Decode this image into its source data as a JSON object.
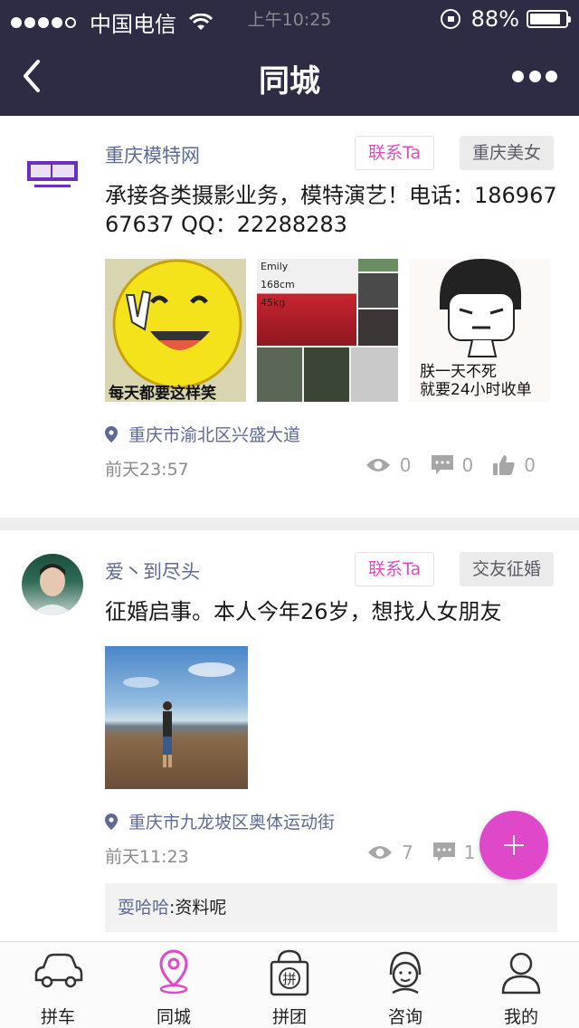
{
  "status_bar": {
    "carrier": "中国电信",
    "time": "上午10:25",
    "battery": "88%",
    "battery_level": 0.88
  },
  "nav": {
    "title": "同城"
  },
  "posts": [
    {
      "author": "重庆模特网",
      "contact_label": "联系Ta",
      "category": "重庆美女",
      "content": "承接各类摄影业务，模特演艺！电话：18696767637 QQ：22288283",
      "images": [
        {
          "caption": "每天都要这样笑"
        },
        {
          "caption_name": "Emily",
          "caption_height": "168cm",
          "caption_weight": "45kg"
        },
        {
          "caption_1": "朕一天不死",
          "caption_2": "就要24小时收单"
        }
      ],
      "location": "重庆市渝北区兴盛大道",
      "time": "前天23:57",
      "views": "0",
      "comments": "0",
      "likes": "0"
    },
    {
      "author": "爱丶到尽头",
      "contact_label": "联系Ta",
      "category": "交友征婚",
      "content": "征婚启事。本人今年26岁，想找人女朋友",
      "location": "重庆市九龙坡区奥体运动街",
      "time": "前天11:23",
      "views": "7",
      "comments": "1",
      "comment": {
        "name": "耍哈哈",
        "text": "资料呢"
      }
    }
  ],
  "tabs": [
    {
      "label": "拼车",
      "active": false
    },
    {
      "label": "同城",
      "active": true
    },
    {
      "label": "拼团",
      "active": false
    },
    {
      "label": "咨询",
      "active": false
    },
    {
      "label": "我的",
      "active": false
    }
  ],
  "colors": {
    "header": "#2e2b45",
    "accent": "#df48c9",
    "link": "#5d6a94"
  }
}
